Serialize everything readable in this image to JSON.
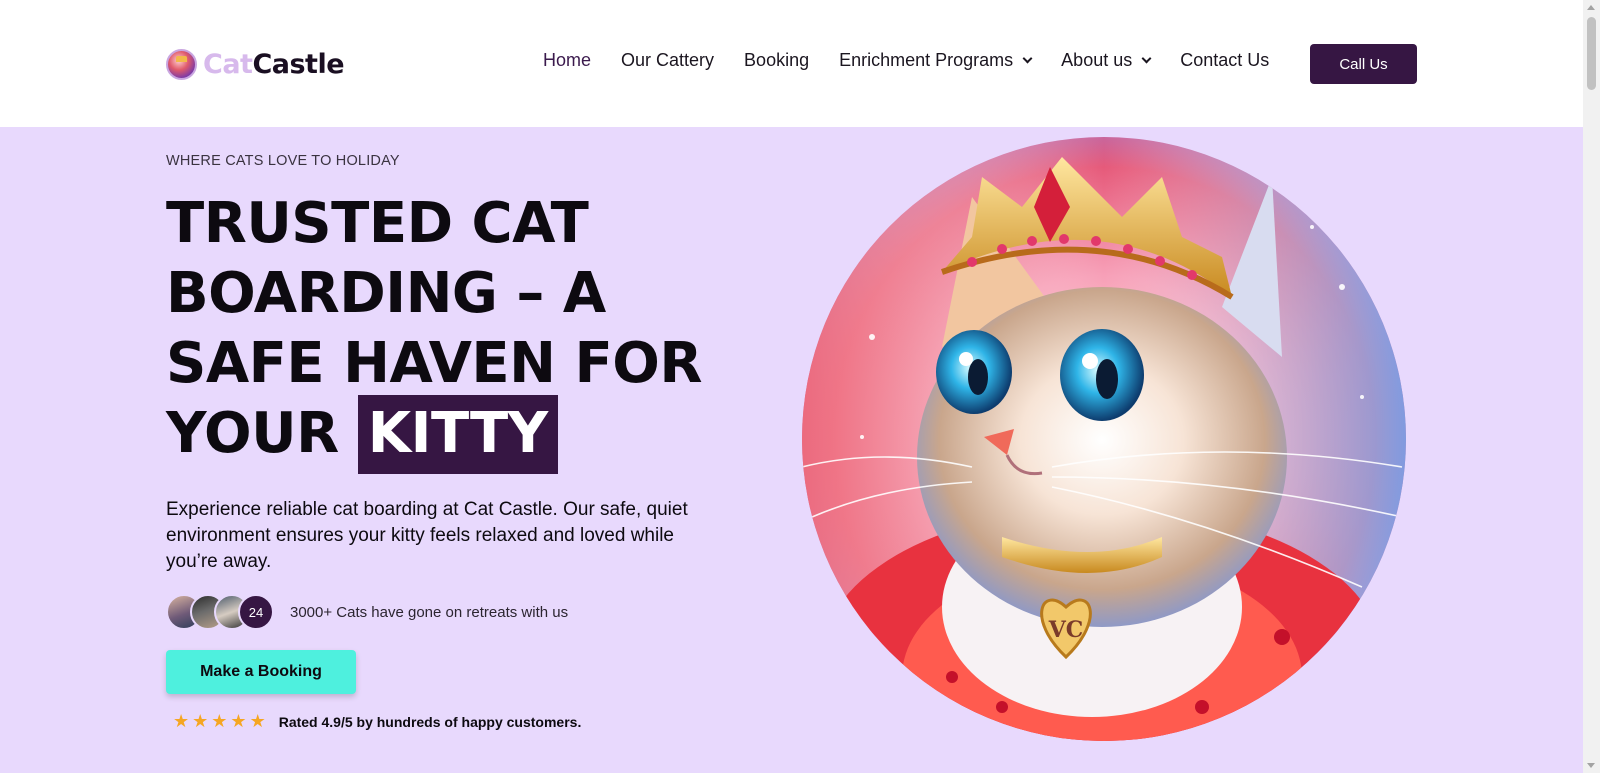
{
  "brand": {
    "name_part_1": "Cat",
    "name_part_2": "Castle",
    "logo_icon": "cat-crown-logo-icon"
  },
  "nav": {
    "items": [
      {
        "label": "Home",
        "active": true
      },
      {
        "label": "Our Cattery"
      },
      {
        "label": "Booking"
      },
      {
        "label": "Enrichment Programs",
        "dropdown": true
      },
      {
        "label": "About us",
        "dropdown": true
      },
      {
        "label": "Contact Us"
      }
    ],
    "cta_label": "Call Us"
  },
  "hero": {
    "eyebrow": "WHERE CATS LOVE TO HOLIDAY",
    "headline_plain": "TRUSTED CAT BOARDING – A SAFE HAVEN FOR YOUR",
    "headline_highlight": "KITTY",
    "lead": "Experience reliable cat boarding at Cat Castle. Our safe, quiet environment ensures your kitty feels relaxed and loved while you’re away.",
    "social_proof": {
      "avatar_count": "24",
      "text": "3000+ Cats have gone on retreats with us"
    },
    "booking_label": "Make a Booking",
    "rating": {
      "stars": 5,
      "star_glyph": "★",
      "text": "Rated 4.9/5 by hundreds of happy customers."
    },
    "image_alt": "cat-with-crown-illustration",
    "pendant_text": "VC"
  },
  "colors": {
    "accent_dark": "#361643",
    "hero_bg": "#e8d9fd",
    "cta_teal": "#4ef0de",
    "star": "#f5a623"
  }
}
